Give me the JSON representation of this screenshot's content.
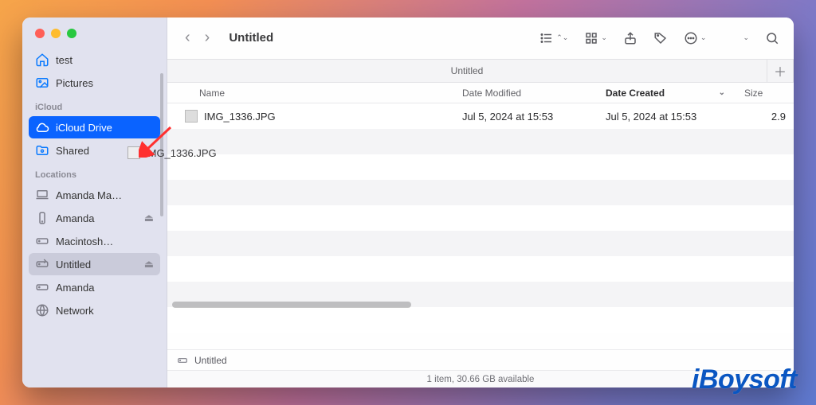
{
  "window": {
    "title": "Untitled"
  },
  "tab": {
    "label": "Untitled"
  },
  "sidebar": {
    "favorites": [
      {
        "label": "test"
      },
      {
        "label": "Pictures"
      }
    ],
    "sections": {
      "icloud_label": "iCloud",
      "locations_label": "Locations"
    },
    "icloud": [
      {
        "label": "iCloud Drive"
      },
      {
        "label": "Shared"
      }
    ],
    "locations": [
      {
        "label": "Amanda Ma…"
      },
      {
        "label": "Amanda"
      },
      {
        "label": "Macintosh…"
      },
      {
        "label": "Untitled"
      },
      {
        "label": "Amanda"
      },
      {
        "label": "Network"
      }
    ]
  },
  "columns": {
    "name": "Name",
    "modified": "Date Modified",
    "created": "Date Created",
    "size": "Size"
  },
  "rows": [
    {
      "name": "IMG_1336.JPG",
      "modified": "Jul 5, 2024 at 15:53",
      "created": "Jul 5, 2024 at 15:53",
      "size": "2.9"
    }
  ],
  "drag_ghost": {
    "label": "IMG_1336.JPG"
  },
  "pathbar": {
    "label": "Untitled"
  },
  "statusbar": {
    "text": "1 item, 30.66 GB available"
  },
  "watermark": {
    "text": "iBoysoft"
  }
}
